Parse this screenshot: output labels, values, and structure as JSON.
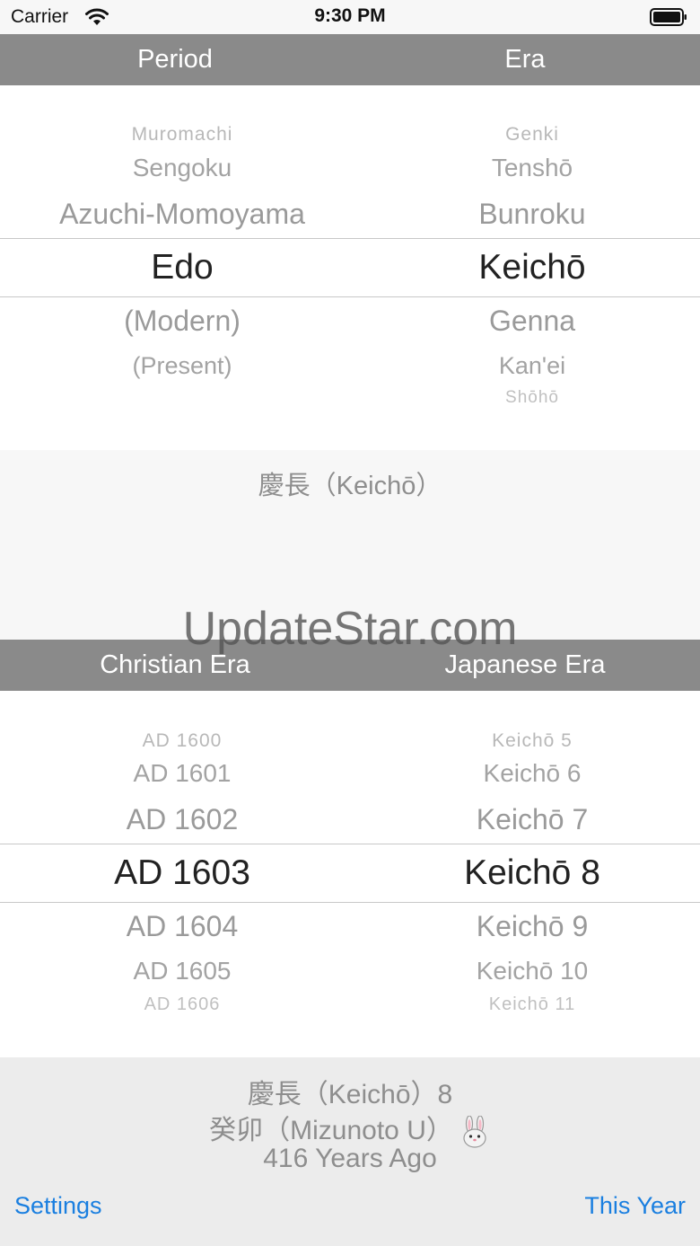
{
  "status_bar": {
    "carrier": "Carrier",
    "time": "9:30 PM",
    "wifi_icon": "wifi-icon",
    "battery_icon": "battery-icon"
  },
  "top_bar": {
    "col1": "Period",
    "col2": "Era"
  },
  "period_picker": {
    "above": [
      "Muromachi",
      "Sengoku",
      "Azuchi-Momoyama"
    ],
    "selected": "Edo",
    "below": [
      "(Modern)",
      "(Present)"
    ]
  },
  "era_picker": {
    "above": [
      "Genki",
      "Tenshō",
      "Bunroku"
    ],
    "selected": "Keichō",
    "below": [
      "Genna",
      "Kan'ei",
      "Shōhō"
    ]
  },
  "selected_era_label": "慶長（Keichō）",
  "watermark": "UpdateStar.com",
  "middle_bar": {
    "col1": "Christian Era",
    "col2": "Japanese Era"
  },
  "christian_picker": {
    "above": [
      "AD 1600",
      "AD 1601",
      "AD 1602"
    ],
    "selected": "AD 1603",
    "below": [
      "AD 1604",
      "AD 1605",
      "AD 1606"
    ]
  },
  "japanese_picker": {
    "above": [
      "Keichō 5",
      "Keichō 6",
      "Keichō 7"
    ],
    "selected": "Keichō 8",
    "below": [
      "Keichō 9",
      "Keichō 10",
      "Keichō 11"
    ]
  },
  "result": {
    "line1": "慶長（Keichō）8",
    "line2": "癸卯（Mizunoto U）",
    "zodiac_icon": "rabbit-icon",
    "line3": "416 Years Ago"
  },
  "buttons": {
    "settings": "Settings",
    "this_year": "This Year"
  },
  "colors": {
    "bar_gray": "#8a8a8a",
    "accent_blue": "#1a7fe0",
    "text_gray": "#8e8e8e"
  }
}
